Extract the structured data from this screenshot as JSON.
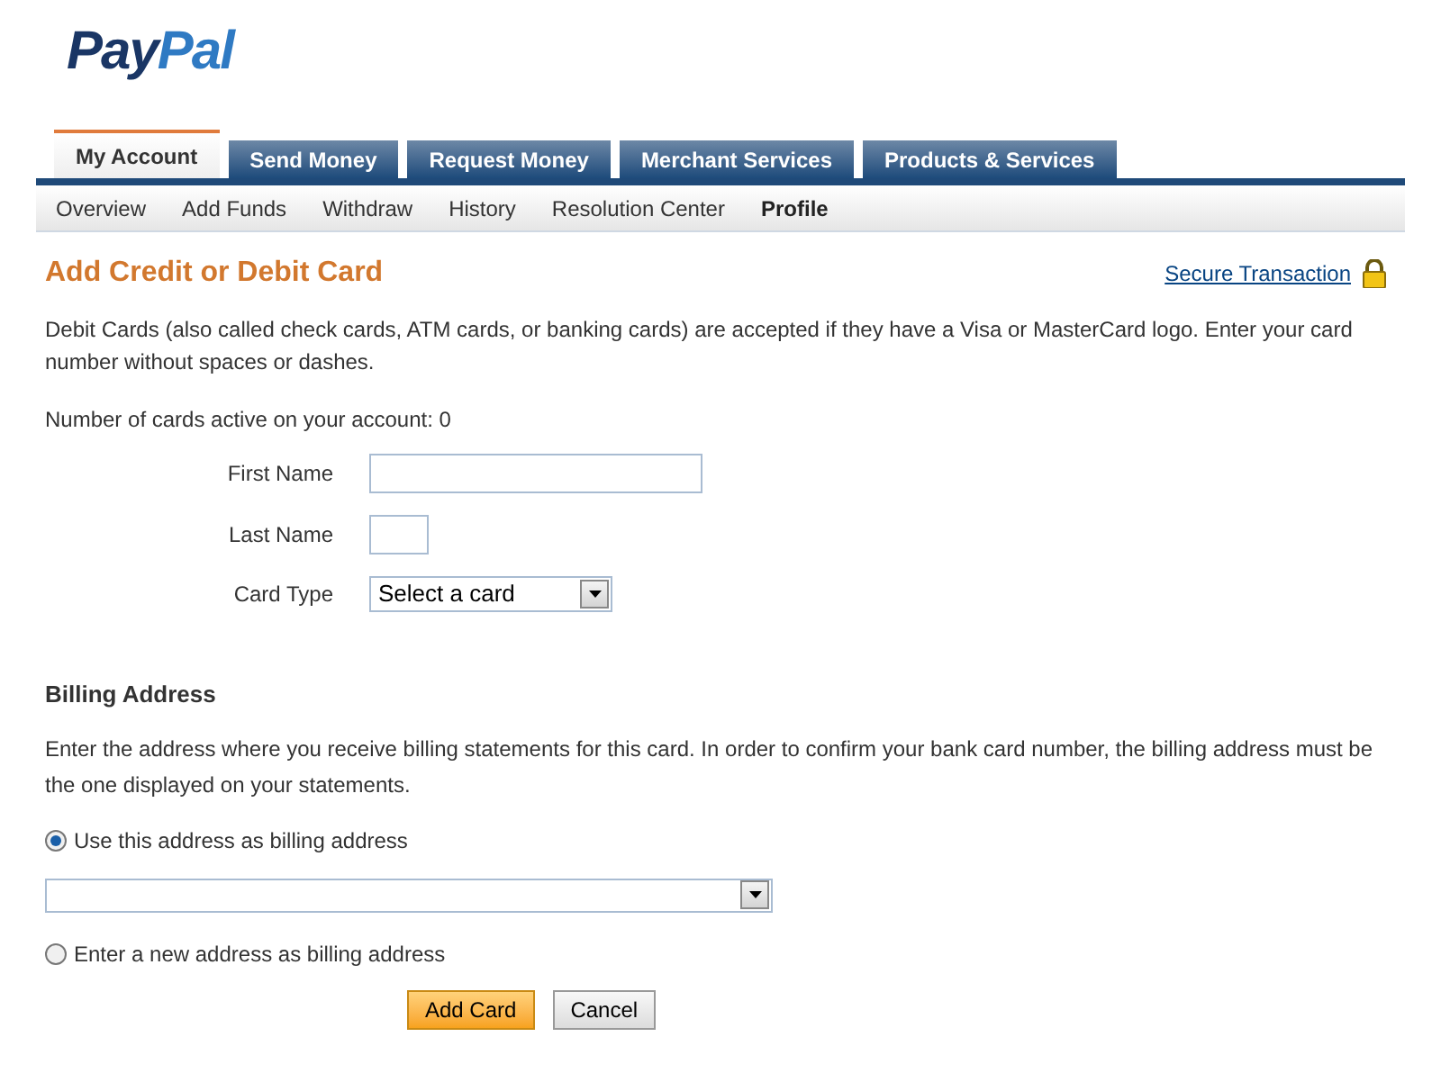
{
  "logo": [
    "Pay",
    "Pal"
  ],
  "tabs": [
    {
      "label": "My Account",
      "selected": true
    },
    {
      "label": "Send Money",
      "selected": false
    },
    {
      "label": "Request Money",
      "selected": false
    },
    {
      "label": "Merchant Services",
      "selected": false
    },
    {
      "label": "Products & Services",
      "selected": false
    }
  ],
  "subnav": [
    {
      "label": "Overview",
      "selected": false
    },
    {
      "label": "Add Funds",
      "selected": false
    },
    {
      "label": "Withdraw",
      "selected": false
    },
    {
      "label": "History",
      "selected": false
    },
    {
      "label": "Resolution Center",
      "selected": false
    },
    {
      "label": "Profile",
      "selected": true
    }
  ],
  "title": "Add Credit or Debit Card",
  "secure_link": "Secure Transaction",
  "intro": "Debit Cards (also called check cards, ATM cards, or banking cards) are accepted if they have a Visa or MasterCard logo. Enter your card number without spaces or dashes.",
  "cards_active": "Number of cards active on your account: 0",
  "fields": [
    {
      "kind": "wide",
      "label": "First Name"
    },
    {
      "kind": "narrow",
      "label": "Last Name"
    },
    {
      "kind": "select",
      "label": "Card Type",
      "value": "Select a card"
    }
  ],
  "billing": {
    "heading": "Billing Address",
    "text": "Enter the address where you receive billing statements for this card. In order to confirm your bank card number, the billing address must be the one displayed on your statements.",
    "options": [
      {
        "label": "Use this address as billing address",
        "selected": true
      },
      {
        "label": "Enter a new address as billing address",
        "selected": false
      }
    ]
  },
  "buttons": [
    {
      "label": "Add Card",
      "kind": "primary"
    },
    {
      "label": "Cancel",
      "kind": "secondary"
    }
  ]
}
